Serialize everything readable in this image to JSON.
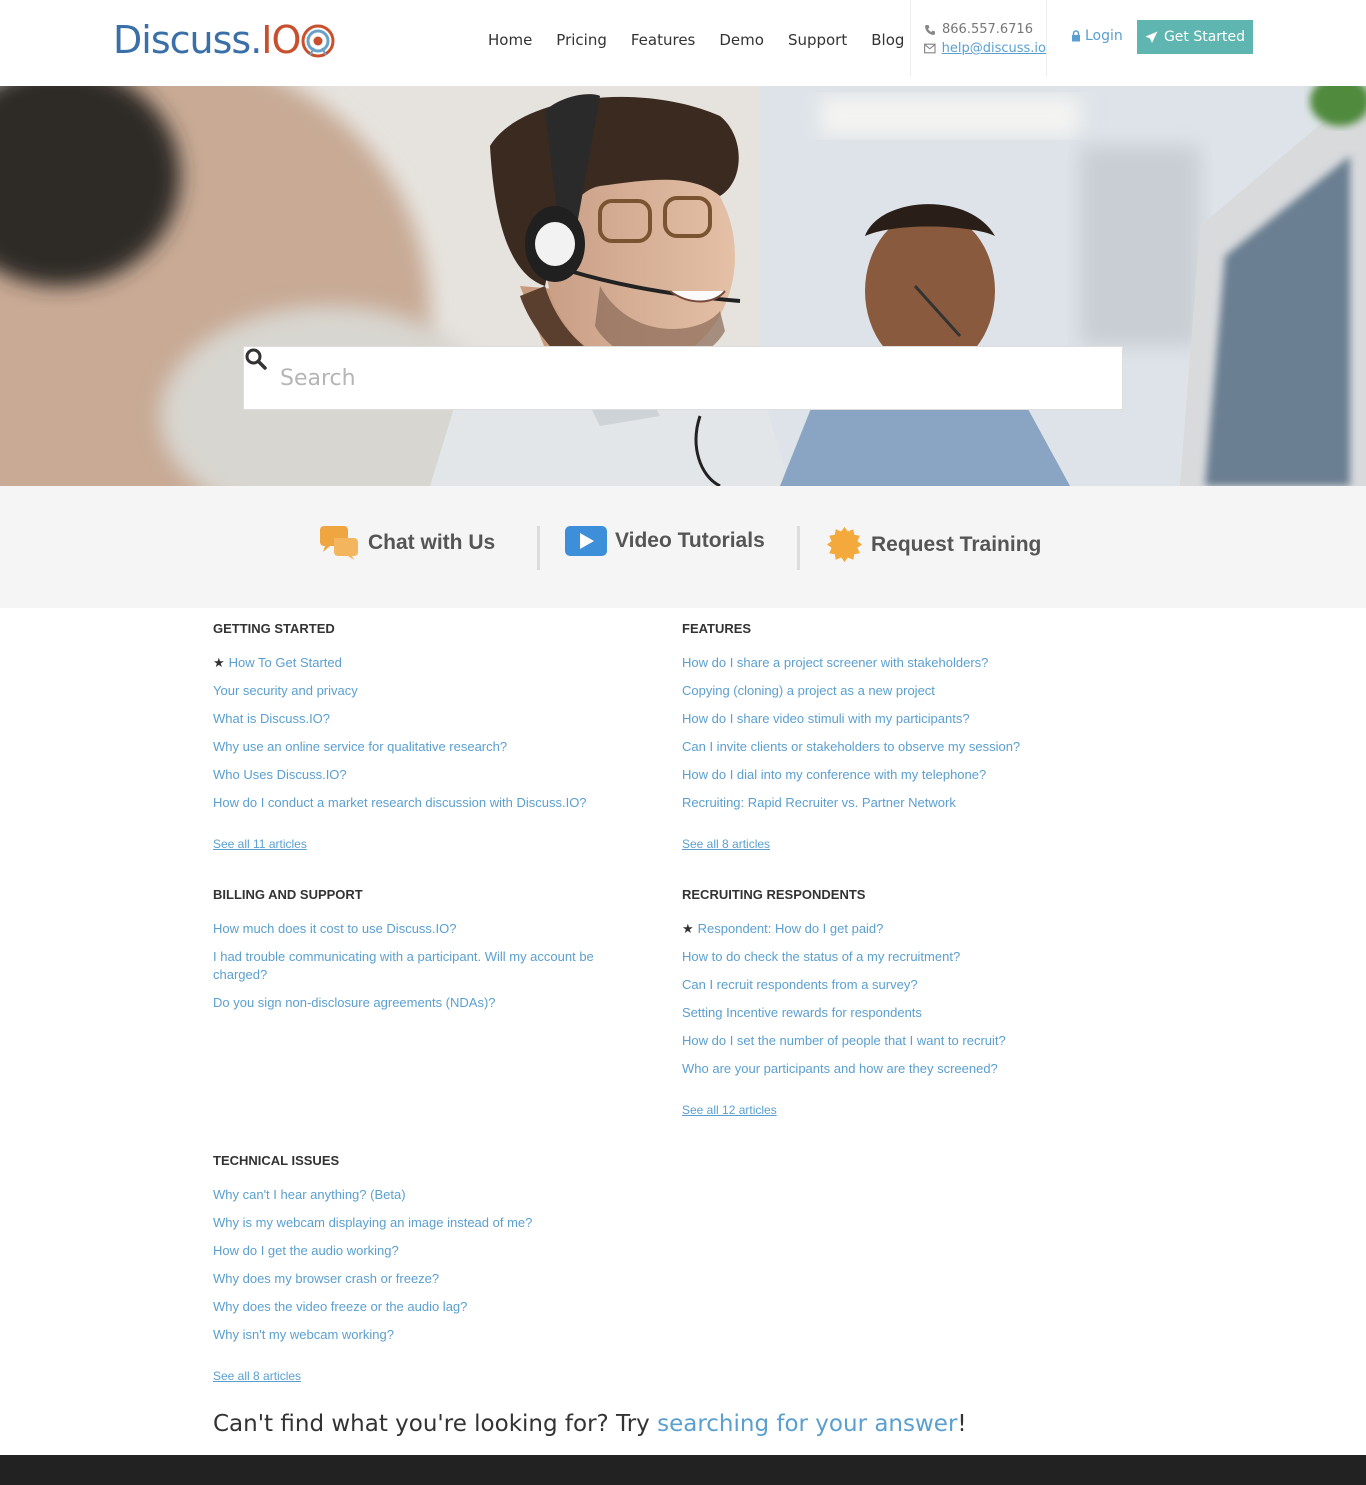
{
  "header": {
    "logo_text": "Discuss.",
    "logo_io": "IO",
    "nav": [
      "Home",
      "Pricing",
      "Features",
      "Demo",
      "Support",
      "Blog"
    ],
    "phone": "866.557.6716",
    "email": "help@discuss.io",
    "login_label": "Login",
    "get_started_label": "Get Started"
  },
  "hero": {
    "search_placeholder": "Search"
  },
  "actions": {
    "chat_label": "Chat with Us",
    "video_label": "Video Tutorials",
    "training_label": "Request Training"
  },
  "categories": {
    "getting_started": {
      "title": "GETTING STARTED",
      "articles": [
        "How To Get Started",
        "Your security and privacy",
        "What is Discuss.IO?",
        "Why use an online service for qualitative research?",
        "Who Uses Discuss.IO?",
        "How do I conduct a market research discussion with Discuss.IO?"
      ],
      "see_all": "See all 11 articles"
    },
    "features": {
      "title": "FEATURES",
      "articles": [
        "How do I share a project screener with stakeholders?",
        "Copying (cloning) a project as a new project",
        "How do I share video stimuli with my participants?",
        "Can I invite clients or stakeholders to observe my session?",
        "How do I dial into my conference with my telephone?",
        "Recruiting: Rapid Recruiter vs. Partner Network"
      ],
      "see_all": "See all 8 articles"
    },
    "billing": {
      "title": "BILLING AND SUPPORT",
      "articles": [
        "How much does it cost to use Discuss.IO?",
        "I had trouble communicating with a participant. Will my account be charged?",
        "Do you sign non-disclosure agreements (NDAs)?"
      ]
    },
    "recruiting": {
      "title": "RECRUITING RESPONDENTS",
      "articles": [
        "Respondent: How do I get paid?",
        "How to do check the status of a my recruitment?",
        "Can I recruit respondents from a survey?",
        "Setting Incentive rewards for respondents",
        "How do I set the number of people that I want to recruit?",
        "Who are your participants and how are they screened?"
      ],
      "see_all": "See all 12 articles"
    },
    "technical": {
      "title": "TECHNICAL ISSUES",
      "articles": [
        "Why can't I hear anything? (Beta)",
        "Why is my webcam displaying an image instead of me?",
        "How do I get the audio working?",
        "Why does my browser crash or freeze?",
        "Why does the video freeze or the audio lag?",
        "Why isn't my webcam working?"
      ],
      "see_all": "See all 8 articles"
    }
  },
  "footer_prompt": {
    "prefix": "Can't find what you're looking for? Try ",
    "link": "searching for your answer",
    "suffix": "!"
  },
  "colors": {
    "link": "#5a9fcf",
    "button": "#5fb5b0",
    "chat_icon": "#f0a640",
    "video_icon": "#3d8fd9",
    "training_icon": "#f3a93c"
  }
}
